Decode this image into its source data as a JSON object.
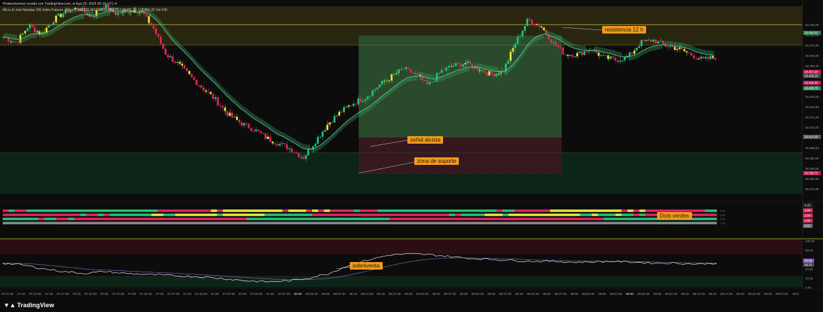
{
  "header": {
    "credit": "Piratesclamour creado con TradingView.com, el Ago 03, 2026 09:14 UTC-4",
    "symbol_line": "Micro E-mini Nasdaq 100 Index Futures · 15s · CME  128.456,50  128.458,75  128.451,50  128.456,25  Vol 240"
  },
  "brand": {
    "name": "TradingView"
  },
  "annotations": {
    "resistencia": "resistencia 12 h",
    "senal": "señal alcista",
    "zona": "zona de soporte",
    "dots": "Dots verdes",
    "sobreventa": "sobreventa"
  },
  "colors": {
    "up": "#23c277",
    "down": "#e0245e",
    "yellow": "#e6e639",
    "resistance_zone": "#3a3510",
    "support_zone": "#0f2a1e",
    "long_box": "#2f5a32",
    "stop_box": "#3d1a22",
    "annotation": "#f29a1a"
  },
  "chart_data": {
    "type": "candlestick",
    "price_axis_labels": [
      "28.490,00",
      "28.480,00",
      "28.470,00",
      "28.462,00",
      "28.456,25",
      "28.450,00",
      "28.438,00",
      "28.430,00",
      "28.422,50",
      "28.414,25",
      "28.410,00",
      "28.404,50",
      "28.398,50",
      "28.392,50",
      "28.386,50",
      "28.380,50",
      "28.375,00"
    ],
    "price_badges": [
      {
        "text": "28.484,50",
        "color": "#2f7d4a"
      },
      {
        "text": "28.457,00",
        "color": "#c2185b"
      },
      {
        "text": "28.456,25",
        "color": "#444444"
      },
      {
        "text": "28.456,00",
        "color": "#c2185b"
      },
      {
        "text": "28.455,75",
        "color": "#2e8b57"
      },
      {
        "text": "28.414,25",
        "color": "#5a5a5a"
      },
      {
        "text": "28.389,75",
        "color": "#c2185b"
      }
    ],
    "time_axis_labels": [
      "07:07:30",
      "07:10",
      "07:12:30",
      "07:15",
      "07:17:30",
      "07:20",
      "07:22:30",
      "07:25",
      "07:27:30",
      "07:30",
      "07:32:30",
      "07:35",
      "07:37:30",
      "07:40",
      "07:42:30",
      "07:45",
      "07:47:30",
      "07:50",
      "07:52:30",
      "07:55",
      "07:57:30",
      "08:00",
      "08:02:30",
      "08:05",
      "08:07:30",
      "08:10",
      "08:12:30",
      "08:15",
      "08:17:30",
      "08:20",
      "08:22:30",
      "08:25",
      "08:27:30",
      "08:30",
      "08:32:30",
      "08:35",
      "08:37:30",
      "08:40",
      "08:42:30",
      "08:45",
      "08:47:30",
      "08:50",
      "08:52:30",
      "08:55",
      "08:57:30",
      "09:00",
      "09:02:30",
      "09:05",
      "09:07:30",
      "09:10",
      "09:12:30",
      "09:15",
      "09:17:30",
      "09:20",
      "09:22:30",
      "09:25",
      "09:27:30",
      "09:3"
    ],
    "close_path": [
      28474,
      28470,
      28482,
      28476,
      28486,
      28492,
      28494,
      28488,
      28496,
      28490,
      28493,
      28492,
      28480,
      28462,
      28455,
      28446,
      28438,
      28430,
      28420,
      28414,
      28410,
      28404,
      28400,
      28396,
      28390,
      28402,
      28414,
      28422,
      28428,
      28432,
      28440,
      28446,
      28452,
      28448,
      28440,
      28450,
      28454,
      28456,
      28452,
      28448,
      28450,
      28470,
      28486,
      28482,
      28470,
      28462,
      28462,
      28466,
      28460,
      28458,
      28460,
      28470,
      28472,
      28468,
      28466,
      28462,
      28458,
      28460
    ],
    "ylim": [
      28375,
      28495
    ],
    "resistance_level": 28490,
    "indicator_panel": {
      "values": [
        "4,43",
        "3,00",
        "2,00",
        "1,00",
        "0,53"
      ],
      "value_colors": [
        "#444444",
        "#e0245e",
        "#e0245e",
        "#e0245e",
        "#666666"
      ],
      "row_labels": [
        "4,00",
        "3,00",
        "2,00",
        "1,00"
      ]
    },
    "oscillator_panel": {
      "axis_labels": [
        "100,00",
        "80,00",
        "60,00",
        "40,00",
        "20,00",
        "0,00"
      ],
      "value_badges": [
        {
          "text": "55,55",
          "color": "#7e57c2"
        },
        {
          "text": "49,70",
          "color": "#444444"
        }
      ],
      "ylim": [
        0,
        100
      ]
    }
  }
}
